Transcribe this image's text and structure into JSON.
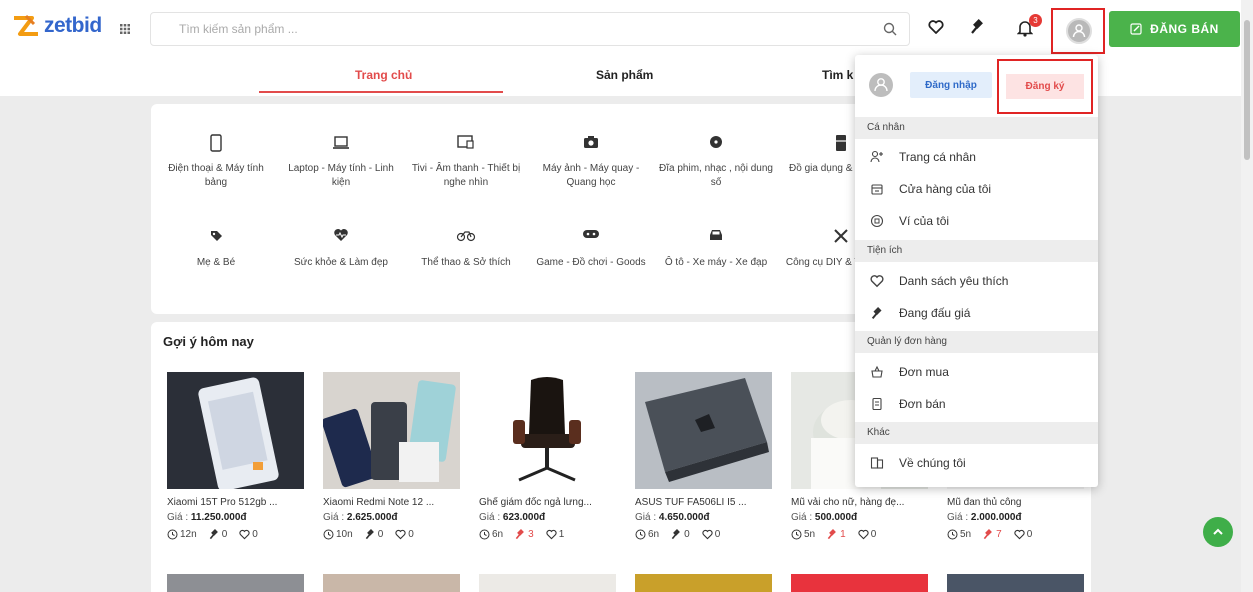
{
  "header": {
    "logo_text": "zetbid",
    "search_placeholder": "Tìm kiếm sản phẩm ...",
    "notification_count": "3",
    "sell_label": "ĐĂNG BÁN",
    "accent": "#4bb34b"
  },
  "nav": {
    "items": [
      {
        "label": "Trang chủ"
      },
      {
        "label": "Sản phẩm"
      },
      {
        "label": "Tìm k"
      }
    ],
    "active_color": "#e24b4b"
  },
  "categories": [
    {
      "label": "Điện thoại & Máy tính bảng",
      "icon": "phone-icon"
    },
    {
      "label": "Laptop - Máy tính - Linh kiện",
      "icon": "laptop-icon"
    },
    {
      "label": "Tivi - Âm thanh - Thiết bị nghe nhìn",
      "icon": "tv-icon"
    },
    {
      "label": "Máy ảnh - Máy quay - Quang học",
      "icon": "camera-icon"
    },
    {
      "label": "Đĩa phim, nhạc , nội dung số",
      "icon": "disc-icon"
    },
    {
      "label": "Đồ gia dụng & Nhà bếp",
      "icon": "fridge-icon"
    },
    {
      "label": "Mẹ & Bé",
      "icon": "baby-icon"
    },
    {
      "label": "Sức khỏe & Làm đẹp",
      "icon": "heart-pulse-icon"
    },
    {
      "label": "Thể thao & Sở thích",
      "icon": "bicycle-icon"
    },
    {
      "label": "Game - Đồ chơi - Goods",
      "icon": "gamepad-icon"
    },
    {
      "label": "Ô tô - Xe máy - Xe đạp",
      "icon": "car-icon"
    },
    {
      "label": "Công cụ DIY & Thủ công",
      "icon": "tools-icon"
    }
  ],
  "suggestions": {
    "title": "Gợi ý hôm nay",
    "price_prefix": "Giá : ",
    "products": [
      {
        "name": "Xiaomi 15T Pro 512gb ...",
        "price": "11.250.000đ",
        "time": "12n",
        "bids": "0",
        "likes": "0",
        "hot": false
      },
      {
        "name": "Xiaomi Redmi Note 12 ...",
        "price": "2.625.000đ",
        "time": "10n",
        "bids": "0",
        "likes": "0",
        "hot": false
      },
      {
        "name": "Ghế giám đốc ngả lưng...",
        "price": "623.000đ",
        "time": "6n",
        "bids": "3",
        "likes": "1",
        "hot": true
      },
      {
        "name": "ASUS TUF FA506LI I5 ...",
        "price": "4.650.000đ",
        "time": "6n",
        "bids": "0",
        "likes": "0",
        "hot": false
      },
      {
        "name": "Mũ vải cho nữ, hàng đẹ...",
        "price": "500.000đ",
        "time": "5n",
        "bids": "1",
        "likes": "0",
        "hot": true
      },
      {
        "name": "Mũ đan thủ công",
        "price": "2.000.000đ",
        "time": "5n",
        "bids": "7",
        "likes": "0",
        "hot": true
      }
    ]
  },
  "dropdown": {
    "login_label": "Đăng nhập",
    "register_label": "Đăng ký",
    "sections": [
      {
        "title": "Cá nhân",
        "items": [
          {
            "label": "Trang cá nhân",
            "icon": "user-plus-icon"
          },
          {
            "label": "Cửa hàng của tôi",
            "icon": "store-icon"
          },
          {
            "label": "Ví của tôi",
            "icon": "wallet-icon"
          }
        ]
      },
      {
        "title": "Tiện ích",
        "items": [
          {
            "label": "Danh sách yêu thích",
            "icon": "heart-icon"
          },
          {
            "label": "Đang đấu giá",
            "icon": "gavel-icon"
          }
        ]
      },
      {
        "title": "Quản lý đơn hàng",
        "items": [
          {
            "label": "Đơn mua",
            "icon": "shopping-bag-icon"
          },
          {
            "label": "Đơn bán",
            "icon": "receipt-icon"
          }
        ]
      },
      {
        "title": "Khác",
        "items": [
          {
            "label": "Về chúng tôi",
            "icon": "info-book-icon"
          }
        ]
      }
    ]
  }
}
